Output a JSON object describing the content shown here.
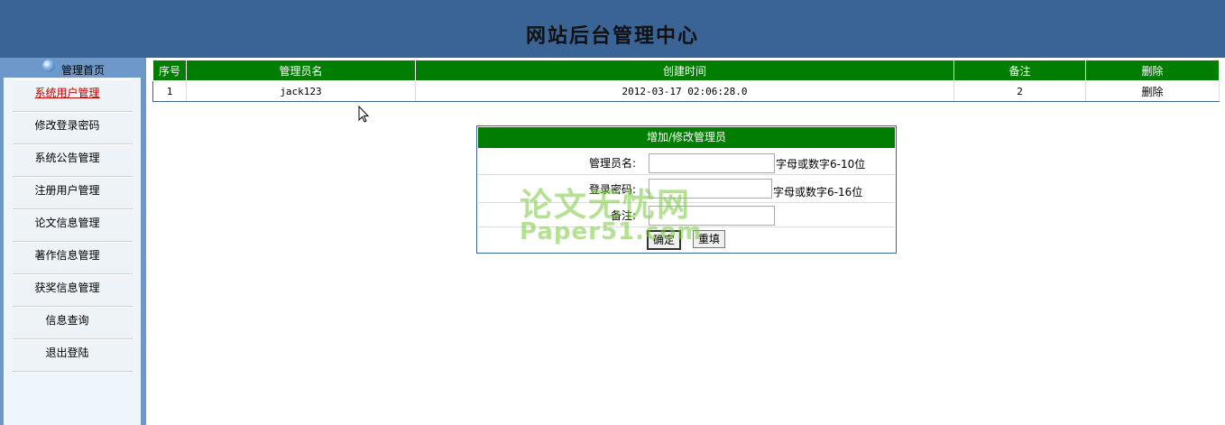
{
  "header": {
    "title": "网站后台管理中心"
  },
  "sidebar": {
    "home_label": "管理首页",
    "items": [
      {
        "label": "系统用户管理",
        "active": true
      },
      {
        "label": "修改登录密码"
      },
      {
        "label": "系统公告管理"
      },
      {
        "label": "注册用户管理"
      },
      {
        "label": "论文信息管理"
      },
      {
        "label": "著作信息管理"
      },
      {
        "label": "获奖信息管理"
      },
      {
        "label": "信息查询"
      },
      {
        "label": "退出登陆"
      }
    ]
  },
  "table": {
    "columns": [
      "序号",
      "管理员名",
      "创建时间",
      "备注",
      "删除"
    ],
    "rows": [
      {
        "index": "1",
        "name": "jack123",
        "created": "2012-03-17 02:06:28.0",
        "note": "2",
        "delete": "删除"
      }
    ]
  },
  "form": {
    "title": "增加/修改管理员",
    "name_label": "管理员名:",
    "name_value": "",
    "name_hint": "字母或数字6-10位",
    "password_label": "登录密码:",
    "password_value": "",
    "password_hint": "字母或数字6-16位",
    "note_label": "备注:",
    "note_value": "",
    "submit_label": "确定",
    "reset_label": "重填"
  },
  "watermark": {
    "line1": "论文无忧网",
    "line2": "Paper51.com"
  },
  "colors": {
    "header": "#3b6496",
    "table_head": "#017d01",
    "sidebar": "#6e98c8"
  }
}
